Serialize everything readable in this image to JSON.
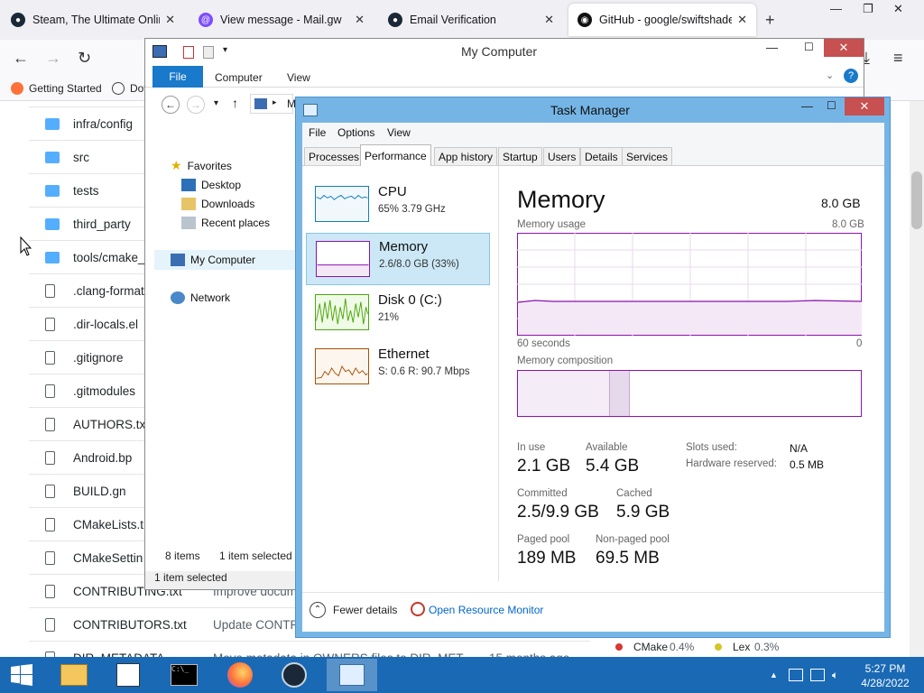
{
  "browser": {
    "tabs": [
      {
        "label": "Steam, The Ultimate Online G",
        "icon": "steam-icon",
        "color": "#1b2838"
      },
      {
        "label": "View message - Mail.gw",
        "icon": "mail-icon",
        "color": "#7c4dff"
      },
      {
        "label": "Email Verification",
        "icon": "steam-icon",
        "color": "#1b2838"
      },
      {
        "label": "GitHub - google/swiftshader",
        "icon": "github-icon",
        "color": "#111111"
      }
    ],
    "bookmarks": [
      {
        "label": "Getting Started",
        "icon": "firefox-icon"
      },
      {
        "label": "Dov",
        "icon": "globe-icon"
      }
    ]
  },
  "github": {
    "rows": [
      {
        "name": "infra/config",
        "type": "folder",
        "msg": "",
        "date": ""
      },
      {
        "name": "src",
        "type": "folder",
        "msg": "",
        "date": ""
      },
      {
        "name": "tests",
        "type": "folder",
        "msg": "",
        "date": ""
      },
      {
        "name": "third_party",
        "type": "folder",
        "msg": "",
        "date": ""
      },
      {
        "name": "tools/cmake_",
        "type": "folder",
        "msg": "",
        "date": ""
      },
      {
        "name": ".clang-format",
        "type": "file",
        "msg": "",
        "date": ""
      },
      {
        "name": ".dir-locals.el",
        "type": "file",
        "msg": "",
        "date": ""
      },
      {
        "name": ".gitignore",
        "type": "file",
        "msg": "",
        "date": ""
      },
      {
        "name": ".gitmodules",
        "type": "file",
        "msg": "",
        "date": ""
      },
      {
        "name": "AUTHORS.txt",
        "type": "file",
        "msg": "",
        "date": ""
      },
      {
        "name": "Android.bp",
        "type": "file",
        "msg": "",
        "date": ""
      },
      {
        "name": "BUILD.gn",
        "type": "file",
        "msg": "",
        "date": ""
      },
      {
        "name": "CMakeLists.t",
        "type": "file",
        "msg": "",
        "date": ""
      },
      {
        "name": "CMakeSettin",
        "type": "file",
        "msg": "",
        "date": ""
      },
      {
        "name": "CONTRIBUTING.txt",
        "type": "file",
        "msg": "Improve docum",
        "date": ""
      },
      {
        "name": "CONTRIBUTORS.txt",
        "type": "file",
        "msg": "Update CONTR",
        "date": ""
      },
      {
        "name": "DIR_METADATA",
        "type": "file",
        "msg": "Move metadata in OWNERS files to DIR_MET...",
        "date": "15 months ago"
      }
    ],
    "peek_items": [
      {
        "label": "CMake",
        "value": "0.4%",
        "color": "#da3633"
      },
      {
        "label": "Lex",
        "value": "0.3%",
        "color": "#d4c52a"
      }
    ]
  },
  "explorer": {
    "title": "My Computer",
    "ribbon": {
      "file": "File",
      "computer": "Computer",
      "view": "View"
    },
    "address_text": "M",
    "nav": [
      {
        "label": "Favorites",
        "icon": "star-icon"
      },
      {
        "label": "Desktop",
        "icon": "desktop-icon"
      },
      {
        "label": "Downloads",
        "icon": "downloads-icon"
      },
      {
        "label": "Recent places",
        "icon": "recent-places-icon"
      },
      {
        "label": "My Computer",
        "icon": "computer-icon"
      },
      {
        "label": "Network",
        "icon": "network-icon"
      }
    ],
    "status_items": "8 items",
    "status_selected": "1 item selected",
    "status_bottom": "1 item selected"
  },
  "taskmanager": {
    "title": "Task Manager",
    "menu": [
      "File",
      "Options",
      "View"
    ],
    "tabs": [
      "Processes",
      "Performance",
      "App history",
      "Startup",
      "Users",
      "Details",
      "Services"
    ],
    "active_tab": "Performance",
    "perf_items": [
      {
        "name": "CPU",
        "value": "65%  3.79 GHz",
        "color": "#117dbb"
      },
      {
        "name": "Memory",
        "value": "2.6/8.0 GB (33%)",
        "color": "#8b12ae"
      },
      {
        "name": "Disk 0 (C:)",
        "value": "21%",
        "color": "#4da60c"
      },
      {
        "name": "Ethernet",
        "value": "S: 0.6  R: 90.7 Mbps",
        "color": "#a74f01"
      }
    ],
    "memory": {
      "heading": "Memory",
      "total": "8.0 GB",
      "usage_label": "Memory usage",
      "usage_max": "8.0 GB",
      "time_left": "60 seconds",
      "time_right": "0",
      "composition_label": "Memory composition",
      "in_use_fraction": 0.33,
      "stats": {
        "in_use_label": "In use",
        "in_use": "2.1 GB",
        "available_label": "Available",
        "available": "5.4 GB",
        "committed_label": "Committed",
        "committed": "2.5/9.9 GB",
        "cached_label": "Cached",
        "cached": "5.9 GB",
        "paged_label": "Paged pool",
        "paged": "189 MB",
        "nonpaged_label": "Non-paged pool",
        "nonpaged": "69.5 MB",
        "slots_label": "Slots used:",
        "slots": "N/A",
        "hwres_label": "Hardware reserved:",
        "hwres": "0.5 MB"
      }
    },
    "footer": {
      "fewer": "Fewer details",
      "monitor": "Open Resource Monitor"
    }
  },
  "taskbar": {
    "time": "5:27 PM",
    "date": "4/28/2022",
    "apps": [
      "file-explorer-icon",
      "notepad-icon",
      "cmd-icon",
      "firefox-icon",
      "steam-icon",
      "task-manager-icon"
    ]
  }
}
